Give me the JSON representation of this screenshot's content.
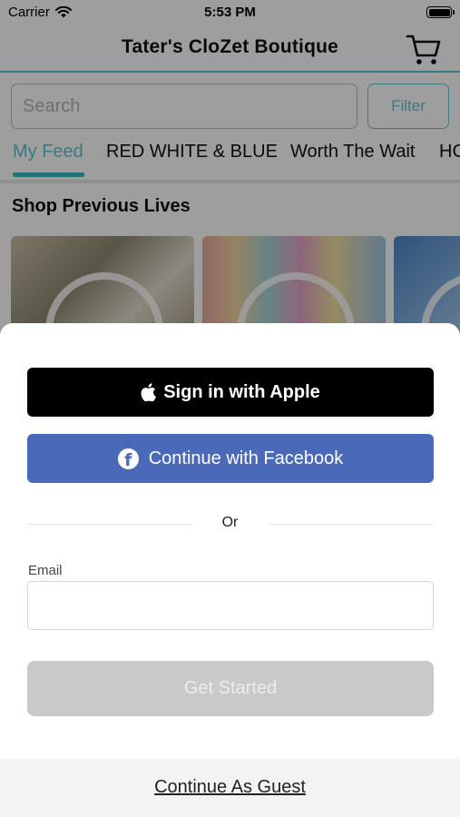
{
  "status_bar": {
    "carrier": "Carrier",
    "time": "5:53 PM"
  },
  "nav": {
    "title": "Tater's CloZet Boutique",
    "cart_icon": "cart-icon"
  },
  "search": {
    "placeholder": "Search",
    "value": "",
    "filter_label": "Filter"
  },
  "tabs": [
    {
      "label": "My Feed",
      "active": true
    },
    {
      "label": "RED WHITE & BLUE",
      "active": false
    },
    {
      "label": "Worth The Wait",
      "active": false
    },
    {
      "label": "HC",
      "active": false
    }
  ],
  "section": {
    "title": "Shop Previous Lives"
  },
  "sheet": {
    "apple_label": "Sign in with Apple",
    "facebook_label": "Continue with Facebook",
    "or_label": "Or",
    "email_label": "Email",
    "email_value": "",
    "get_started_label": "Get Started",
    "guest_label": "Continue As Guest"
  },
  "colors": {
    "accent": "#5cc6cd",
    "facebook": "#4a69b8",
    "apple": "#000000",
    "disabled_button": "#c9c9c9"
  }
}
